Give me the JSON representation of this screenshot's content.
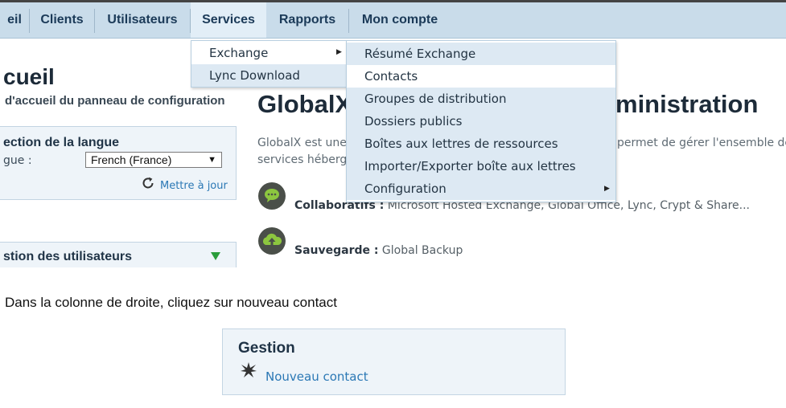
{
  "nav": {
    "items": [
      {
        "label": "eil"
      },
      {
        "label": "Clients"
      },
      {
        "label": "Utilisateurs"
      },
      {
        "label": "Services"
      },
      {
        "label": "Rapports"
      },
      {
        "label": "Mon compte"
      }
    ]
  },
  "services_menu": {
    "items": [
      {
        "label": "Exchange"
      },
      {
        "label": "Lync Download"
      }
    ]
  },
  "exchange_menu": {
    "items": [
      {
        "label": "Résumé Exchange"
      },
      {
        "label": "Contacts"
      },
      {
        "label": "Groupes de distribution"
      },
      {
        "label": "Dossiers publics"
      },
      {
        "label": "Boîtes aux lettres de ressources"
      },
      {
        "label": "Importer/Exporter boîte aux lettres"
      },
      {
        "label": "Configuration"
      }
    ]
  },
  "page": {
    "title": "cueil",
    "subtitle": "d'accueil du panneau de configuration"
  },
  "language_panel": {
    "title": "ection de la langue",
    "label": "gue :",
    "selected": "French (France)",
    "update_label": "Mettre à jour"
  },
  "users_panel": {
    "title": "stion des utilisateurs"
  },
  "main": {
    "title_left": "GlobalX",
    "title_right": "ministration",
    "desc_line1_left": "GlobalX est une",
    "desc_line1_right": "permet de gérer l'ensemble de",
    "desc_line2_left": "services héberg",
    "features": [
      {
        "label": "Collaboratifs :",
        "text": " Microsoft Hosted Exchange, Global Office, Lync, Crypt & Share..."
      },
      {
        "label": "Sauvegarde :",
        "text": " Global Backup"
      }
    ]
  },
  "instruction": "Dans la colonne de droite, cliquez sur nouveau contact",
  "gestion": {
    "title": "Gestion",
    "new_contact_label": "Nouveau contact"
  },
  "colors": {
    "navbar_bg": "#c9dcea",
    "link": "#2b78b5",
    "accent_green": "#2a9d3b"
  }
}
